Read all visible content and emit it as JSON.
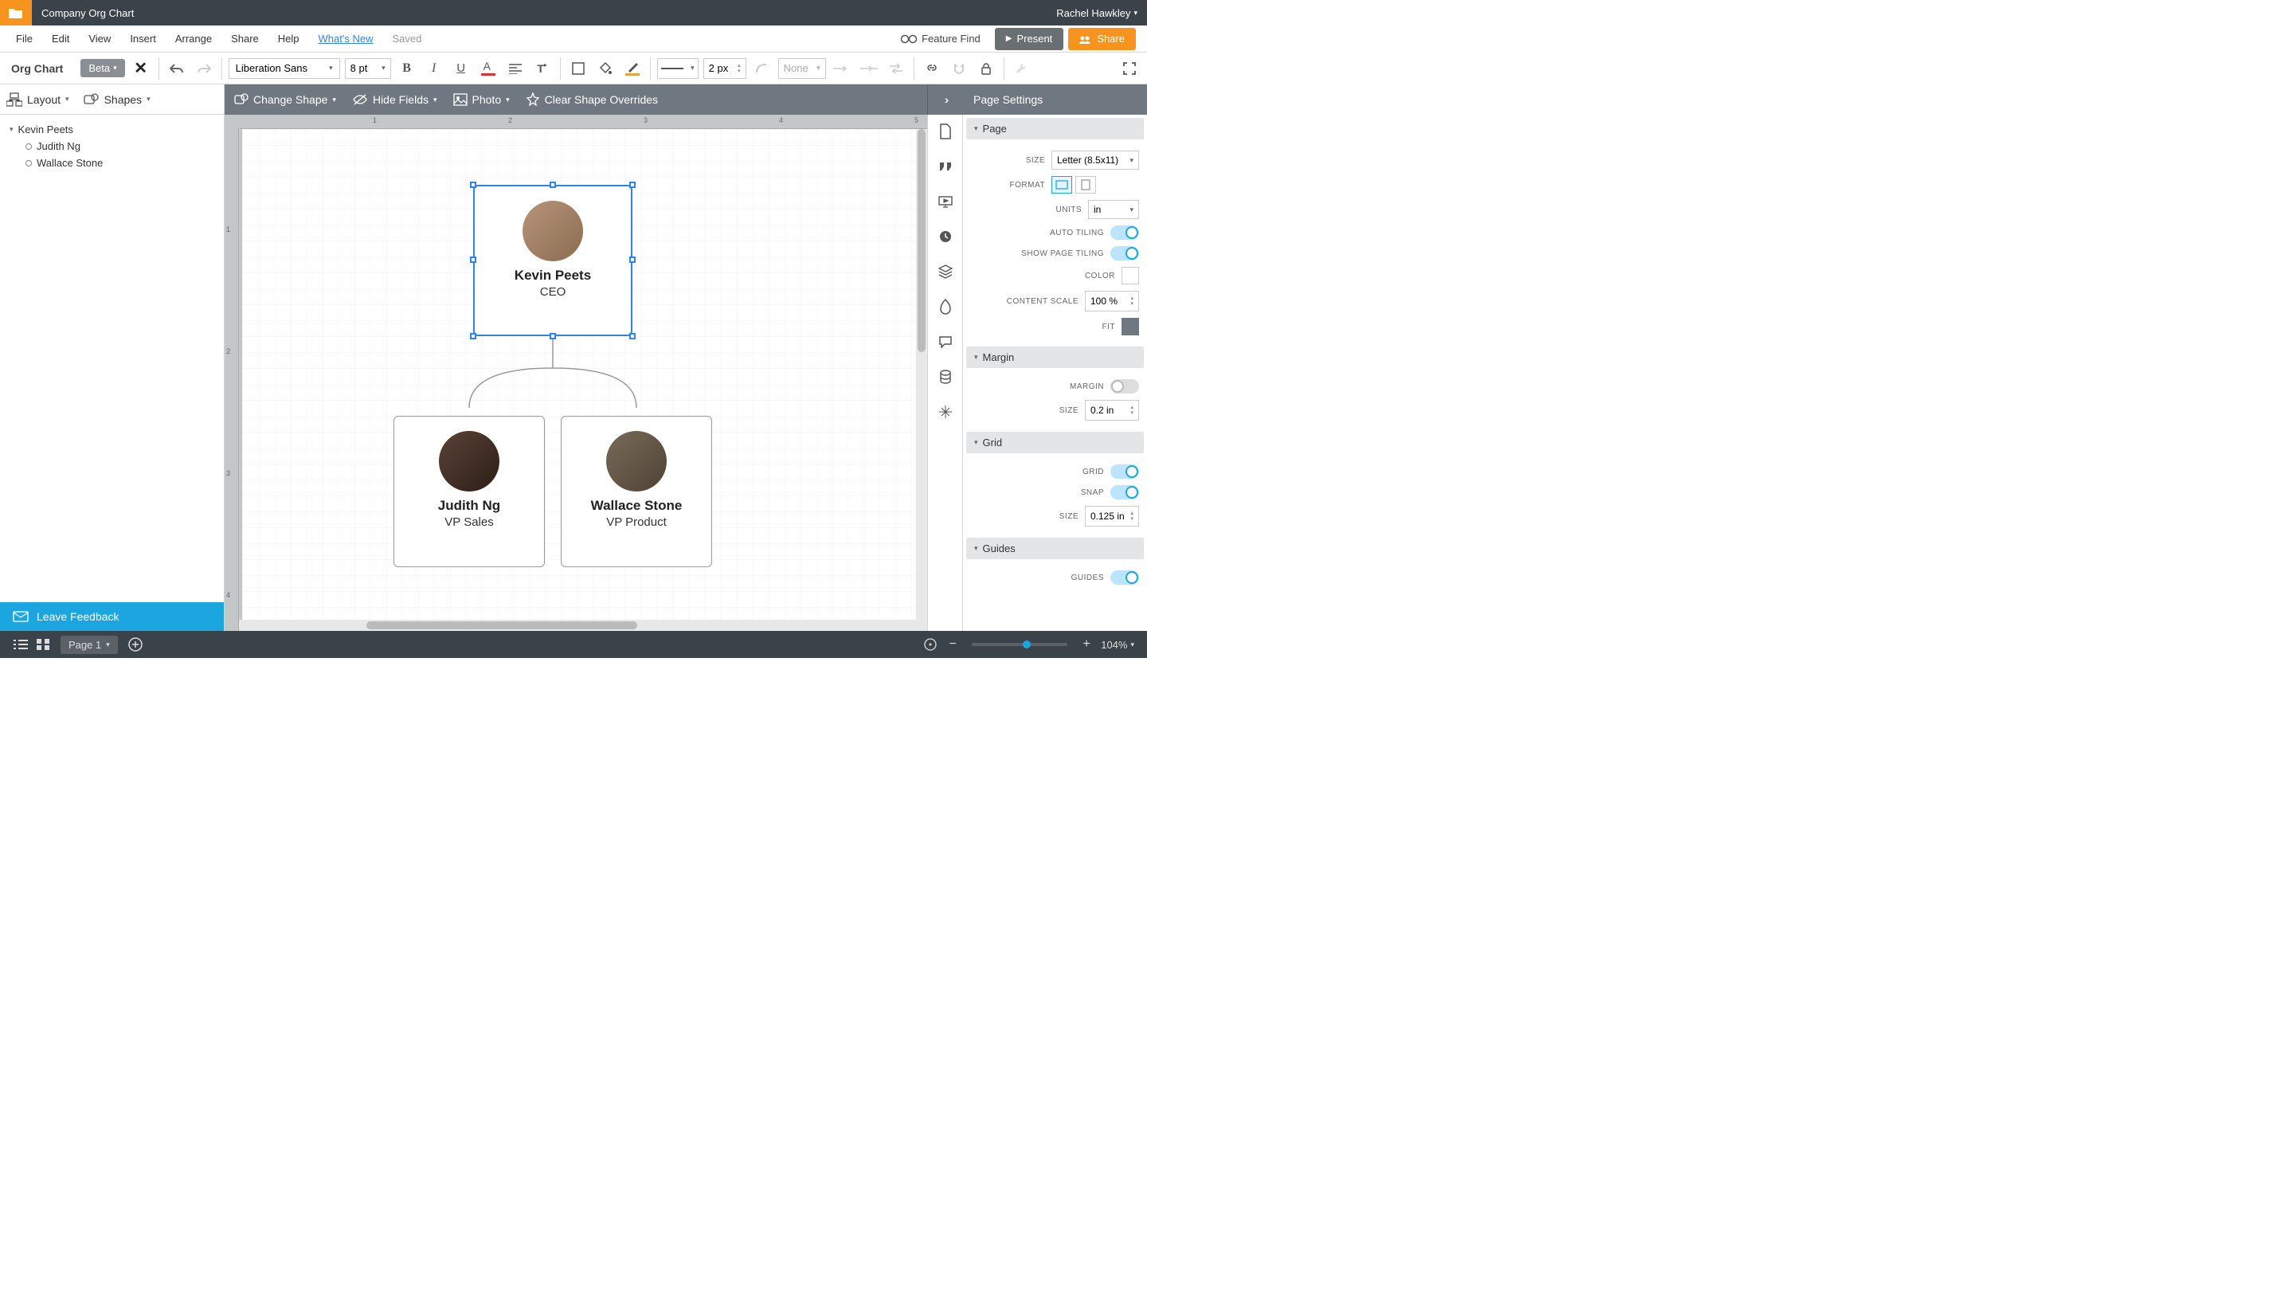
{
  "top": {
    "doc_title": "Company Org Chart",
    "user_name": "Rachel Hawkley"
  },
  "menu": {
    "file": "File",
    "edit": "Edit",
    "view": "View",
    "insert": "Insert",
    "arrange": "Arrange",
    "share": "Share",
    "help": "Help",
    "whats_new": "What's New",
    "saved": "Saved",
    "feature_find": "Feature Find",
    "present": "Present",
    "share_btn": "Share"
  },
  "toolbar": {
    "mode_label": "Org Chart",
    "beta": "Beta",
    "font": "Liberation Sans",
    "font_size": "8 pt",
    "stroke_width": "2 px",
    "arrow_style": "None"
  },
  "subtoolbar": {
    "layout": "Layout",
    "shapes": "Shapes",
    "change_shape": "Change Shape",
    "hide_fields": "Hide Fields",
    "photo": "Photo",
    "clear_overrides": "Clear Shape Overrides",
    "page_settings": "Page Settings"
  },
  "tree": {
    "root": "Kevin Peets",
    "children": [
      "Judith Ng",
      "Wallace Stone"
    ],
    "feedback": "Leave Feedback"
  },
  "org": {
    "cards": [
      {
        "name": "Kevin Peets",
        "role": "CEO"
      },
      {
        "name": "Judith Ng",
        "role": "VP Sales"
      },
      {
        "name": "Wallace Stone",
        "role": "VP Product"
      }
    ]
  },
  "settings": {
    "sections": {
      "page": "Page",
      "margin": "Margin",
      "grid": "Grid",
      "guides": "Guides"
    },
    "labels": {
      "size": "Size",
      "format": "Format",
      "units": "Units",
      "auto_tiling": "Auto Tiling",
      "show_page_tiling": "Show Page Tiling",
      "color": "Color",
      "content_scale": "Content Scale",
      "fit": "Fit",
      "margin": "Margin",
      "margin_size": "Size",
      "grid": "Grid",
      "snap": "Snap",
      "grid_size": "Size",
      "guides": "Guides"
    },
    "values": {
      "page_size": "Letter (8.5x11)",
      "units": "in",
      "content_scale": "100 %",
      "margin_size": "0.2 in",
      "grid_size": "0.125 in"
    }
  },
  "bottom": {
    "page_label": "Page 1",
    "zoom": "104%"
  },
  "rulers": {
    "h": [
      "1",
      "2",
      "3",
      "4",
      "5"
    ],
    "v": [
      "1",
      "2",
      "3",
      "4"
    ]
  }
}
